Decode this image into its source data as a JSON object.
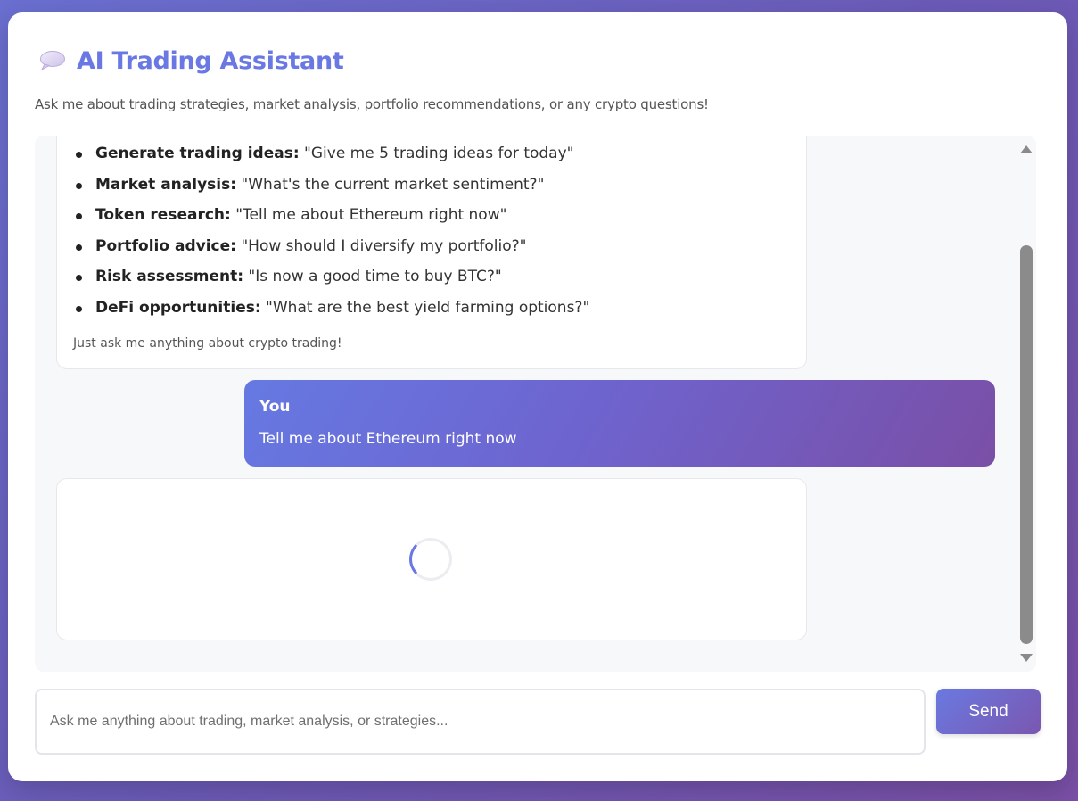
{
  "header": {
    "icon": "speech-bubble-icon",
    "title": "AI Trading Assistant",
    "subtitle": "Ask me about trading strategies, market analysis, portfolio recommendations, or any crypto questions!"
  },
  "chat": {
    "assistant_intro": {
      "examples": [
        {
          "label": "Generate trading ideas:",
          "prompt": "\"Give me 5 trading ideas for today\""
        },
        {
          "label": "Market analysis:",
          "prompt": "\"What's the current market sentiment?\""
        },
        {
          "label": "Token research:",
          "prompt": "\"Tell me about Ethereum right now\""
        },
        {
          "label": "Portfolio advice:",
          "prompt": "\"How should I diversify my portfolio?\""
        },
        {
          "label": "Risk assessment:",
          "prompt": "\"Is now a good time to buy BTC?\""
        },
        {
          "label": "DeFi opportunities:",
          "prompt": "\"What are the best yield farming options?\""
        }
      ],
      "closing": "Just ask me anything about crypto trading!"
    },
    "user_message": {
      "sender": "You",
      "text": "Tell me about Ethereum right now"
    },
    "assistant_reply": {
      "state": "loading"
    }
  },
  "composer": {
    "placeholder": "Ask me anything about trading, market analysis, or strategies...",
    "value": "",
    "send_label": "Send"
  },
  "colors": {
    "accent": "#6a78e3",
    "gradient_start": "#6679e2",
    "gradient_end": "#7a4fa6"
  }
}
